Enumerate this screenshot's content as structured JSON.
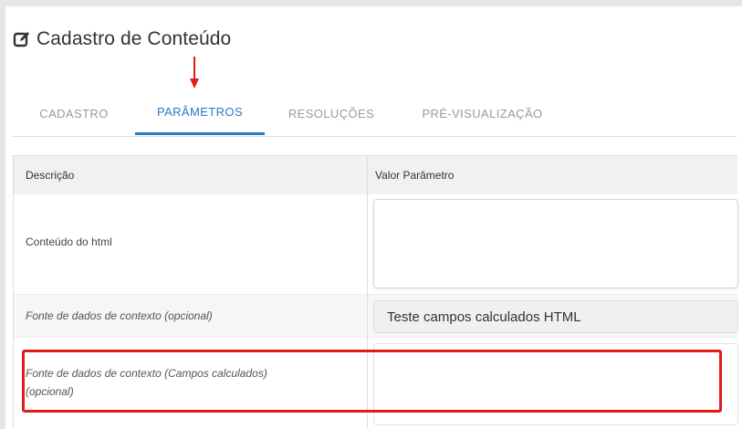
{
  "page": {
    "title": "Cadastro de Conteúdo",
    "title_icon": "edit-icon"
  },
  "tabs": [
    {
      "label": "CADASTRO",
      "active": false
    },
    {
      "label": "PARÂMETROS",
      "active": true
    },
    {
      "label": "RESOLUÇÕES",
      "active": false
    },
    {
      "label": "PRÉ-VISUALIZAÇÃO",
      "active": false
    }
  ],
  "table": {
    "headers": {
      "description": "Descrição",
      "value": "Valor Parâmetro"
    },
    "rows": [
      {
        "description": "Conteúdo do html",
        "value": ""
      },
      {
        "description": "Fonte de dados de contexto (opcional)",
        "value": "Teste campos calculados HTML"
      },
      {
        "description": "Fonte de dados de contexto (Campos calculados) (opcional)",
        "value": ""
      }
    ]
  },
  "colors": {
    "accent": "#2e78c4",
    "annotation": "#e21a1a"
  }
}
